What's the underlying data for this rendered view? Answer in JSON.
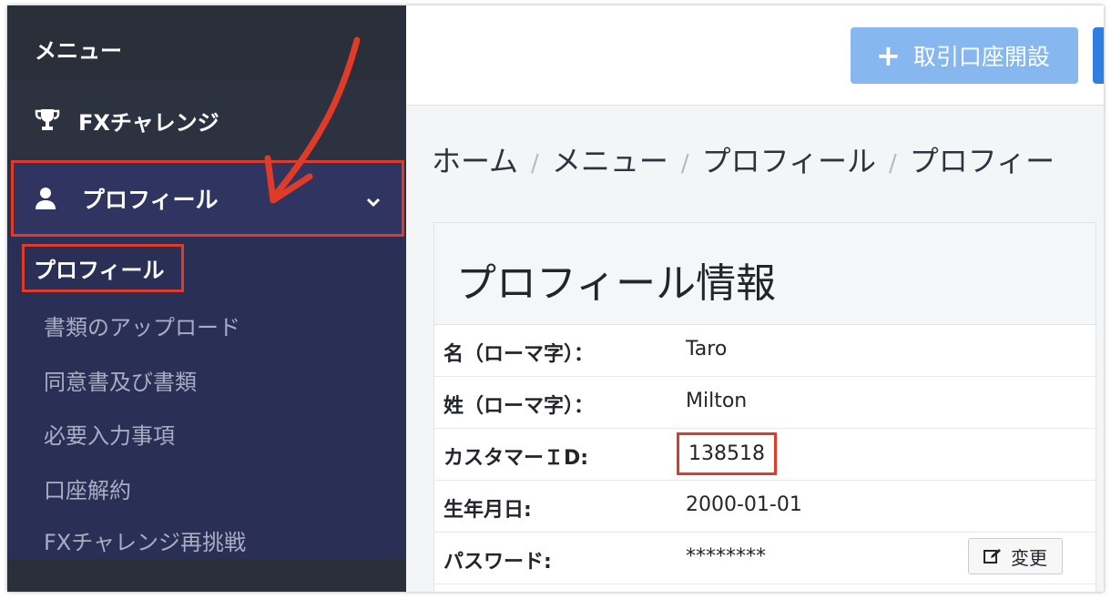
{
  "sidebar": {
    "menu_title": "メニュー",
    "fx_challenge": "FXチャレンジ",
    "profile": "プロフィール",
    "submenu": [
      "プロフィール",
      "書類のアップロード",
      "同意書及び書類",
      "必要入力事項",
      "口座解約",
      "FXチャレンジ再挑戦"
    ]
  },
  "header": {
    "open_account_label": "取引口座開設"
  },
  "breadcrumb": [
    "ホーム",
    "メニュー",
    "プロフィール",
    "プロフィー"
  ],
  "breadcrumb_sep": "/",
  "card": {
    "title": "プロフィール情報",
    "rows": [
      {
        "label": "名（ローマ字）：",
        "value": "Taro"
      },
      {
        "label": "姓（ローマ字）：",
        "value": "Milton"
      },
      {
        "label": "カスタマーＩD:",
        "value": "138518"
      },
      {
        "label": "生年月日:",
        "value": "2000-01-01"
      },
      {
        "label": "パスワード:",
        "value": "********"
      }
    ],
    "change_label": "変更"
  },
  "icons": {
    "trophy": "trophy-icon",
    "user": "user-icon",
    "chevron": "chevron-down-icon",
    "plus": "plus-icon",
    "edit": "edit-icon"
  },
  "colors": {
    "sidebar_bg": "#2b2f3a",
    "submenu_bg": "#2a2f55",
    "highlight": "#e03a28",
    "primary_light": "#86b7ee",
    "primary": "#2f7fe0"
  }
}
